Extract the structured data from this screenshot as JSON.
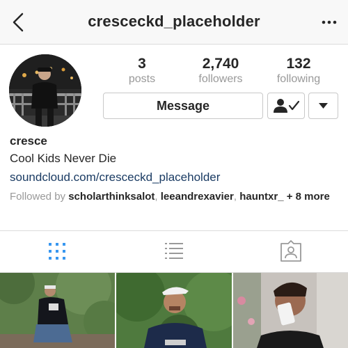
{
  "header": {
    "username": "cresceckd_placeholder"
  },
  "stats": {
    "posts": {
      "value": "3",
      "label": "posts"
    },
    "followers": {
      "value": "2,740",
      "label": "followers"
    },
    "following": {
      "value": "132",
      "label": "following"
    }
  },
  "actions": {
    "message_label": "Message"
  },
  "profile": {
    "name": "cresce",
    "bio": "Cool Kids Never Die",
    "link": "soundcloud.com/cresceckd_placeholder",
    "followed_by_prefix": "Followed by",
    "followed_by_users": [
      "scholarthinksalot",
      "leeandrexavier",
      "hauntxr_"
    ],
    "followed_by_suffix": "+ 8 more"
  },
  "tabs": [
    {
      "icon": "grid-icon"
    },
    {
      "icon": "list-icon"
    },
    {
      "icon": "tagged-photos-icon"
    }
  ],
  "colors": {
    "accent": "#3897f0",
    "link": "#1a3b63",
    "muted": "#999999"
  }
}
